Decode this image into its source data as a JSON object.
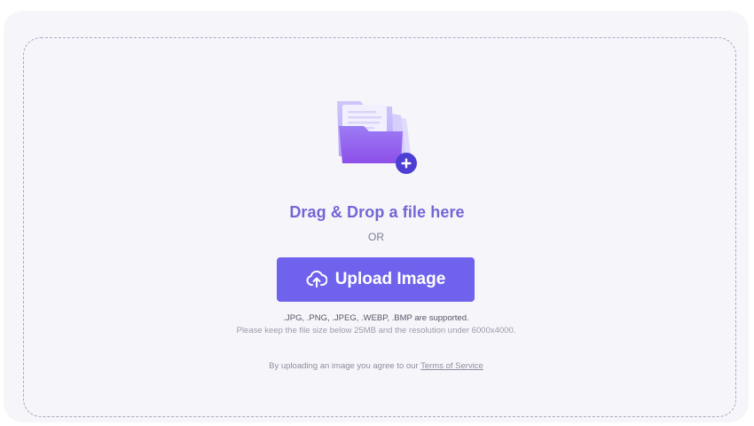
{
  "upload_panel": {
    "title": "Drag & Drop a file here",
    "separator": "OR",
    "upload_button_label": "Upload Image",
    "supported_formats": ".JPG, .PNG, .JPEG, .WEBP, .BMP are supported.",
    "limits_note": "Please keep the file size below 25MB and the resolution under 6000x4000.",
    "terms_prefix": "By uploading an image you agree to our ",
    "terms_link": "Terms of Service"
  },
  "icons": {
    "folder": "folder-add-icon",
    "upload": "cloud-upload-icon"
  },
  "colors": {
    "accent": "#6f62ec",
    "title": "#7266d6",
    "background": "#f6f6fa"
  }
}
